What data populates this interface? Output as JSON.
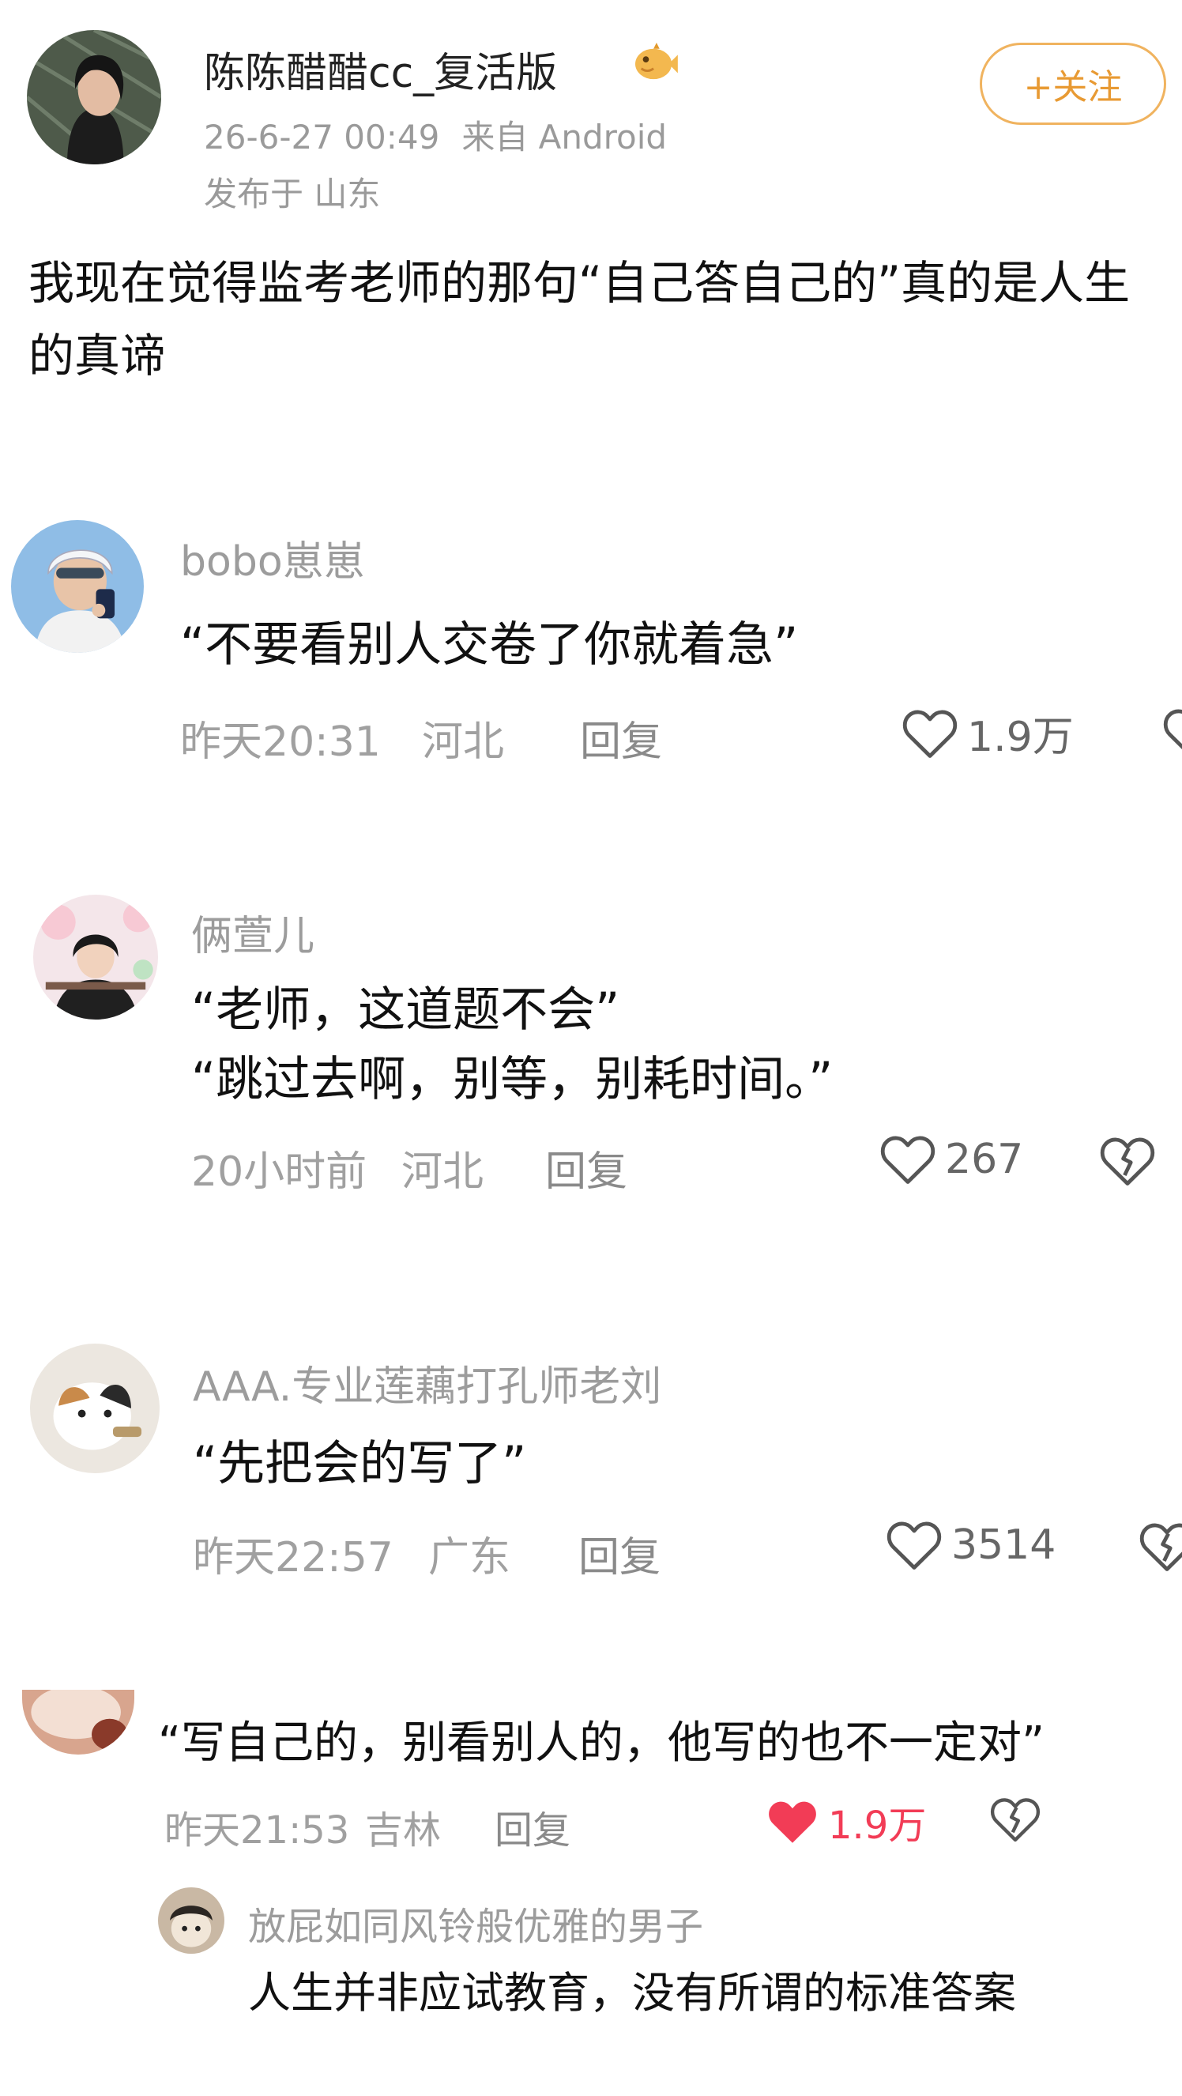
{
  "post": {
    "author": "陈陈醋醋cc_复活版",
    "time": "26-6-27 00:49",
    "source": "来自 Android",
    "location": "发布于 山东",
    "follow_label": "+关注",
    "content": "我现在觉得监考老师的那句“自己答自己的”真的是人生的真谛"
  },
  "comments": [
    {
      "user": "bobo崽崽",
      "text": "“不要看别人交卷了你就着急”",
      "time": "昨天20:31",
      "region": "河北",
      "reply": "回复",
      "likes": "1.9万"
    },
    {
      "user": "俩萱儿",
      "lines": [
        "“老师，这道题不会”",
        "“跳过去啊，别等，别耗时间。”"
      ],
      "time": "20小时前",
      "region": "河北",
      "reply": "回复",
      "likes": "267"
    },
    {
      "user": "AAA.专业莲藕打孔师老刘",
      "text": "“先把会的写了”",
      "time": "昨天22:57",
      "region": "广东",
      "reply": "回复",
      "likes": "3514"
    },
    {
      "text": "“写自己的，别看别人的，他写的也不一定对”",
      "time": "昨天21:53",
      "region": "吉林",
      "reply": "回复",
      "likes": "1.9万",
      "liked": true
    }
  ],
  "sub_reply": {
    "user": "放屁如同风铃般优雅的男子",
    "text": "人生并非应试教育，没有所谓的标准答案"
  },
  "colors": {
    "accent": "#f0b35f",
    "liked": "#f23c56"
  }
}
